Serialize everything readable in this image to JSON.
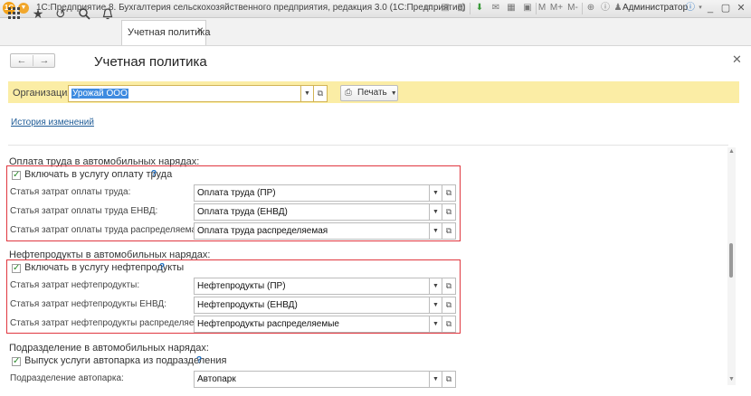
{
  "window": {
    "logo": "1С",
    "title": "1С:Предприятие 8. Бухгалтерия сельскохозяйственного предприятия, редакция 3.0  (1С:Предприятие)",
    "user": "Администратор",
    "toolbar_icons": [
      "doc-icon",
      "save-icon",
      "print-icon",
      "mail-icon",
      "calendar-icon",
      "calculator-icon",
      "report-icon",
      "m-icon",
      "mplus-icon",
      "mminus-icon",
      "zoom-icon",
      "info-icon"
    ],
    "memory_labels": [
      "M",
      "M+",
      "M-"
    ]
  },
  "nav": {
    "tab_label": "Учетная политика"
  },
  "form": {
    "title": "Учетная политика",
    "org_label": "Организация:",
    "org_value": "Урожай ООО",
    "print_label": "Печать",
    "history_link": "История изменений"
  },
  "sections": {
    "labor": {
      "title": "Оплата труда в автомобильных нарядах:",
      "checkbox_label": "Включать в услугу оплату труда",
      "checked": true,
      "help": "?",
      "rows": [
        {
          "label": "Статья затрат оплаты труда:",
          "value": "Оплата труда (ПР)"
        },
        {
          "label": "Статья затрат оплаты труда ЕНВД:",
          "value": "Оплата труда (ЕНВД)"
        },
        {
          "label": "Статья затрат оплаты труда распределяемая:",
          "value": "Оплата труда распределяемая"
        }
      ]
    },
    "fuel": {
      "title": "Нефтепродукты в автомобильных нарядах:",
      "checkbox_label": "Включать в услугу нефтепродукты",
      "checked": true,
      "help": "?",
      "rows": [
        {
          "label": "Статья затрат нефтепродукты:",
          "value": "Нефтепродукты (ПР)"
        },
        {
          "label": "Статья затрат нефтепродукты ЕНВД:",
          "value": "Нефтепродукты (ЕНВД)"
        },
        {
          "label": "Статья затрат нефтепродукты распределяемая:",
          "value": "Нефтепродукты распределяемые"
        }
      ]
    },
    "division": {
      "title": "Подразделение в автомобильных нарядах:",
      "checkbox_label": "Выпуск услуги автопарка из подразделения",
      "checked": true,
      "help": "?",
      "row": {
        "label": "Подразделение автопарка:",
        "value": "Автопарк"
      }
    }
  },
  "colors": {
    "org_bar": "#fbeda5",
    "highlight_border": "#e0373f",
    "link": "#1f5c97",
    "selection": "#3e8be0"
  }
}
